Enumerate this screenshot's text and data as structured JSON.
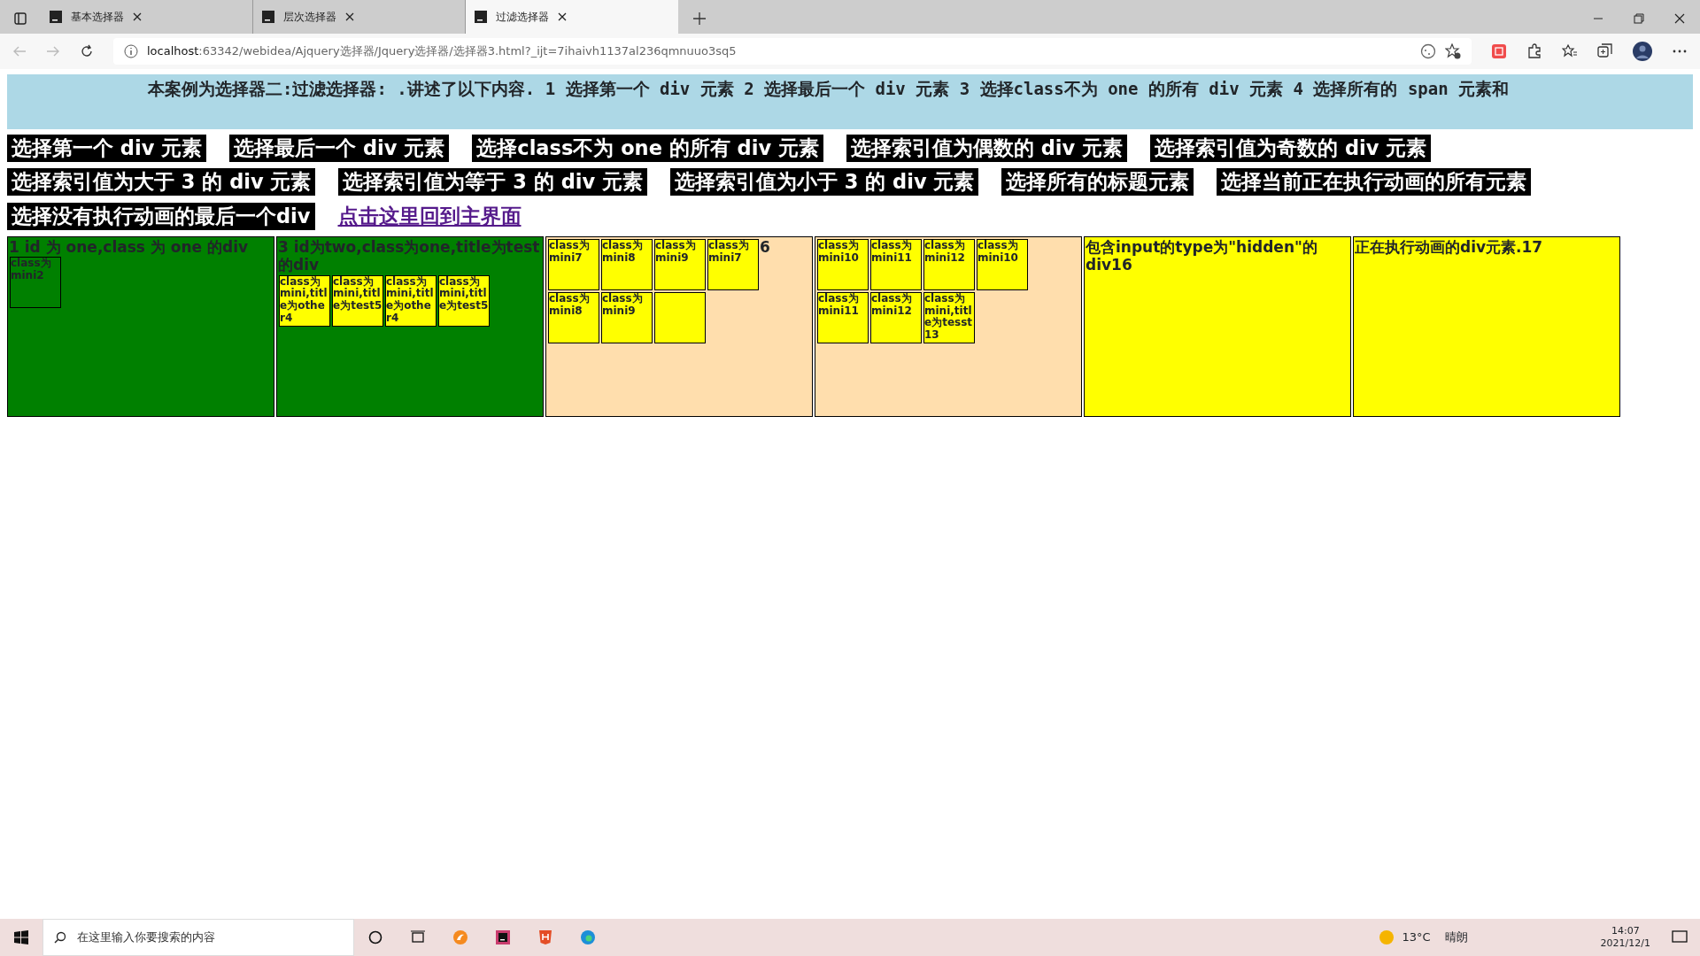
{
  "browser": {
    "tabs": [
      {
        "label": "基本选择器",
        "selected": false
      },
      {
        "label": "层次选择器",
        "selected": false
      },
      {
        "label": "过滤选择器",
        "selected": true
      }
    ],
    "address": {
      "host": "localhost",
      "rest": ":63342/webidea/Ajquery选择器/Jquery选择器/选择器3.html?_ijt=7ihaivh1137al236qmnuuo3sq5"
    }
  },
  "banner": {
    "text": "本案例为选择器二:过滤选择器: .讲述了以下内容. 1 选择第一个 div 元素 2 选择最后一个 div 元素 3 选择class不为 one 的所有 div 元素 4 选择所有的 span 元素和"
  },
  "buttons": [
    "选择第一个 div 元素",
    "选择最后一个 div 元素",
    "选择class不为 one 的所有 div 元素",
    "选择索引值为偶数的 div 元素",
    "选择索引值为奇数的 div 元素",
    "选择索引值为大于 3 的 div 元素",
    "选择索引值为等于 3 的 div 元素",
    "选择索引值为小于 3 的 div 元素",
    "选择所有的标题元素",
    "选择当前正在执行动画的所有元素",
    "选择没有执行动画的最后一个div"
  ],
  "link": "点击这里回到主界面",
  "boxes": [
    {
      "color": "#008000",
      "children": [
        {
          "kind": "text",
          "text": "1 id 为 one,class 为 one 的div"
        },
        {
          "kind": "mini",
          "text": "class为mini2",
          "highlighted": false
        }
      ]
    },
    {
      "color": "#008000",
      "children": [
        {
          "kind": "text",
          "text": "3 id为two,class为one,title为test的div"
        },
        {
          "kind": "mini",
          "text": "class为mini,title为other4",
          "highlighted": true
        },
        {
          "kind": "mini",
          "text": "class为mini,title为test5",
          "highlighted": true
        },
        {
          "kind": "mini",
          "text": "class为mini,title为other4",
          "highlighted": true
        },
        {
          "kind": "mini",
          "text": "class为mini,title为test5",
          "highlighted": true
        }
      ]
    },
    {
      "color": "#ffdead",
      "children": [
        {
          "kind": "mini",
          "text": "class为mini7",
          "highlighted": true
        },
        {
          "kind": "mini",
          "text": "class为mini8",
          "highlighted": true
        },
        {
          "kind": "mini",
          "text": "class为mini9",
          "highlighted": true
        },
        {
          "kind": "mini",
          "text": "class为mini7",
          "highlighted": true
        },
        {
          "kind": "text",
          "text": "6"
        },
        {
          "kind": "mini",
          "text": "class为mini8",
          "highlighted": true
        },
        {
          "kind": "mini",
          "text": "class为mini9",
          "highlighted": true
        },
        {
          "kind": "mini",
          "highlighted": true
        }
      ]
    },
    {
      "color": "#ffdead",
      "children": [
        {
          "kind": "mini",
          "text": "class为mini10",
          "highlighted": true
        },
        {
          "kind": "mini",
          "text": "class为mini11",
          "highlighted": true
        },
        {
          "kind": "mini",
          "text": "class为mini12",
          "highlighted": true
        },
        {
          "kind": "mini",
          "text": "class为mini10",
          "highlighted": true
        },
        {
          "kind": "mini",
          "text": "class为mini11",
          "highlighted": true
        },
        {
          "kind": "mini",
          "text": "class为mini12",
          "highlighted": true
        },
        {
          "kind": "mini",
          "text": "class为mini,title为tesst13",
          "highlighted": true
        }
      ]
    },
    {
      "color": "#ffff00",
      "children": [
        {
          "kind": "text",
          "text": "包含input的type为\"hidden\"的div16"
        }
      ]
    },
    {
      "color": "#ffff00",
      "children": [
        {
          "kind": "text",
          "text": "正在执行动画的div元素.17"
        }
      ]
    }
  ],
  "taskbar": {
    "search_placeholder": "在这里输入你要搜索的内容",
    "temperature": "13°C",
    "weather": "晴朗",
    "time": "14:07",
    "date": "2021/12/1"
  }
}
